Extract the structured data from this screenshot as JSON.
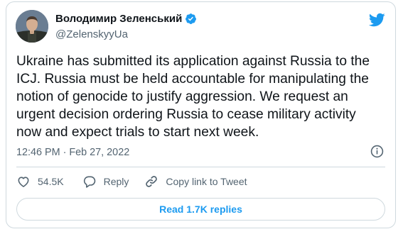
{
  "author": {
    "display_name": "Володимир Зеленський",
    "handle": "@ZelenskyyUa",
    "verified_icon": "verified-badge-icon",
    "avatar_bg": "#5b6f84"
  },
  "tweet": {
    "text": "Ukraine has submitted its application against Russia to the\nICJ. Russia must be held accountable for manipulating the\nnotion of genocide to justify aggression. We request an\nurgent decision ordering Russia to cease military activity\nnow and expect trials to start next week.",
    "timestamp": "12:46 PM · Feb 27, 2022"
  },
  "actions": {
    "likes_count": "54.5K",
    "reply_label": "Reply",
    "copy_link_label": "Copy link to Tweet"
  },
  "replies_button": {
    "label": "Read 1.7K replies"
  },
  "icons": {
    "brand": "twitter-bird-icon",
    "info": "info-icon",
    "like": "heart-icon",
    "reply": "reply-bubble-icon",
    "copy": "link-icon"
  },
  "colors": {
    "accent": "#1d9bf0",
    "secondary_text": "#536471",
    "border": "#cfd9de"
  }
}
